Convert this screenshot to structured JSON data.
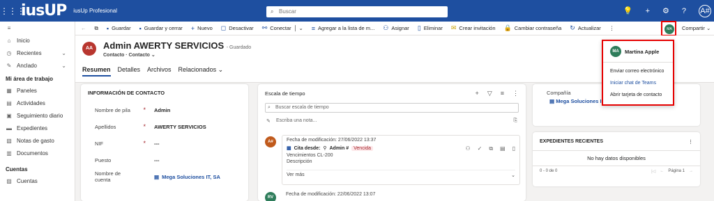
{
  "topbar": {
    "app_title": "iusUp Profesional",
    "logo": "iusUP",
    "search_placeholder": "Buscar",
    "user_initials": "A#"
  },
  "commands": [
    {
      "label": "Guardar",
      "icon": "save-icon"
    },
    {
      "label": "Guardar y cerrar",
      "icon": "save-close-icon"
    },
    {
      "label": "Nuevo",
      "icon": "plus-icon"
    },
    {
      "label": "Desactivar",
      "icon": "deactivate-icon"
    },
    {
      "label": "Conectar",
      "icon": "connect-icon"
    },
    {
      "label": "Agregar a la lista de m...",
      "icon": "list-icon"
    },
    {
      "label": "Asignar",
      "icon": "assign-icon"
    },
    {
      "label": "Eliminar",
      "icon": "trash-icon"
    },
    {
      "label": "Crear invitación",
      "icon": "invite-icon"
    },
    {
      "label": "Cambiar contraseña",
      "icon": "lock-icon"
    },
    {
      "label": "Actualizar",
      "icon": "refresh-icon"
    }
  ],
  "share": {
    "initials": "MA",
    "label": "Compartir"
  },
  "sidebar": {
    "top_items": [
      {
        "label": "Inicio",
        "icon": "home-icon"
      },
      {
        "label": "Recientes",
        "icon": "clock-icon"
      },
      {
        "label": "Anclado",
        "icon": "pin-icon"
      }
    ],
    "section_work": "Mi área de trabajo",
    "work_items": [
      {
        "label": "Paneles",
        "icon": "dashboard-icon"
      },
      {
        "label": "Actividades",
        "icon": "activity-icon"
      },
      {
        "label": "Seguimiento diario",
        "icon": "tracking-icon"
      },
      {
        "label": "Expedientes",
        "icon": "folder-icon"
      },
      {
        "label": "Notas de gasto",
        "icon": "expense-icon"
      },
      {
        "label": "Documentos",
        "icon": "document-icon"
      }
    ],
    "section_accounts": "Cuentas",
    "account_items": [
      {
        "label": "Cuentas",
        "icon": "accounts-icon"
      }
    ]
  },
  "record": {
    "initials": "AA",
    "title": "Admin AWERTY SERVICIOS",
    "saved": "- Guardado",
    "sub": "Contacto · Contacto",
    "tabs": [
      "Resumen",
      "Detalles",
      "Archivos",
      "Relacionados"
    ]
  },
  "contact": {
    "title": "INFORMACIÓN DE CONTACTO",
    "fields": [
      {
        "label": "Nombre de pila",
        "value": "Admin",
        "required": "*"
      },
      {
        "label": "Apellidos",
        "value": "AWERTY SERVICIOS",
        "required": "*"
      },
      {
        "label": "NIF",
        "value": "---",
        "required": "*"
      },
      {
        "label": "Puesto",
        "value": "---",
        "required": ""
      },
      {
        "label": "Nombre de cuenta",
        "value": "Mega Soluciones IT, SA",
        "required": ""
      }
    ]
  },
  "timeline": {
    "title": "Escala de tiempo",
    "search_placeholder": "Buscar escala de tiempo",
    "note_placeholder": "Escriba una nota...",
    "entry1": {
      "initials": "A#",
      "date": "Fecha de modificación: 27/06/2022 13:37",
      "cita": "Cita desde:",
      "owner": "Admin #",
      "badge": "Vencida",
      "line1": "Vencimientos CL-200",
      "line2": "Descripción",
      "more": "Ver más"
    },
    "entry2": {
      "initials": "RV",
      "date": "Fecha de modificación: 22/06/2022 13:07"
    }
  },
  "company": {
    "label": "Compañía",
    "value": "Mega Soluciones I"
  },
  "expedientes": {
    "title": "EXPEDIENTES RECIENTES",
    "empty": "No hay datos disponibles",
    "count": "0 - 0 de 0",
    "page": "Página 1"
  },
  "popup": {
    "initials": "MA",
    "name": "Martina Apple",
    "items": [
      "Enviar correo electrónico",
      "Iniciar chat de Teams",
      "Abrir tarjeta de contacto"
    ]
  }
}
